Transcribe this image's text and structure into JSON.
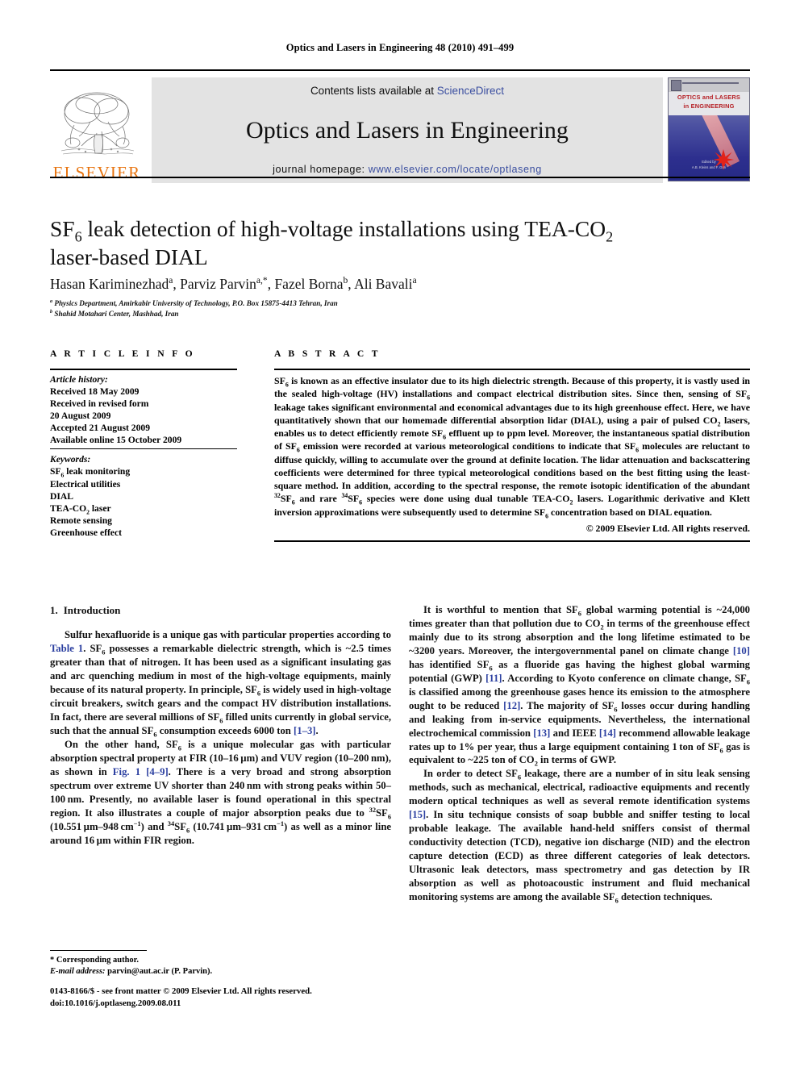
{
  "running_head": "Optics and Lasers in Engineering 48 (2010) 491–499",
  "banner": {
    "publisher_name": "ELSEVIER",
    "contents_prefix": "Contents lists available at ",
    "contents_link": "ScienceDirect",
    "journal_title": "Optics and Lasers in Engineering",
    "homepage_prefix": "journal homepage: ",
    "homepage_url": "www.elsevier.com/locate/optlaseng",
    "cover": {
      "title_line1": "OPTICS and LASERS",
      "title_line2": "in ENGINEERING",
      "credit_line1": "Edited by",
      "credit_line2": "A.B. Kleins and F. Gori"
    },
    "link_color": "#3b4fa0",
    "elsevier_orange": "#E87511"
  },
  "article": {
    "title_line1_a": "SF",
    "title_line1_sub": "6",
    "title_line1_b": " leak detection of high-voltage installations using TEA-CO",
    "title_line1_sub2": "2",
    "title_line2": "laser-based DIAL",
    "authors_plain": "Hasan Kariminezhad a, Parviz Parvin a,*, Fazel Borna b, Ali Bavali a",
    "affiliation_a": "Physics Department, Amirkabir University of Technology, P.O. Box 15875-4413 Tehran, Iran",
    "affiliation_b": "Shahid Motahari Center, Mashhad, Iran"
  },
  "article_info": {
    "heading": "A R T I C L E   I N F O",
    "history_label": "Article history:",
    "history": [
      "Received 18 May 2009",
      "Received in revised form",
      "20 August 2009",
      "Accepted 21 August 2009",
      "Available online 15 October 2009"
    ],
    "keywords_label": "Keywords:",
    "keywords": [
      "SF6 leak monitoring",
      "Electrical utilities",
      "DIAL",
      "TEA-CO2 laser",
      "Remote sensing",
      "Greenhouse effect"
    ]
  },
  "abstract": {
    "heading": "A B S T R A C T",
    "copyright": "© 2009 Elsevier Ltd. All rights reserved."
  },
  "introduction": {
    "section_number": "1.",
    "section_title": "Introduction"
  },
  "footnotes": {
    "corresponding": "* Corresponding author.",
    "email_label": "E-mail address:",
    "email": "parvin@aut.ac.ir (P. Parvin).",
    "issn_line": "0143-8166/$ - see front matter © 2009 Elsevier Ltd. All rights reserved.",
    "doi_line": "doi:10.1016/j.optlaseng.2009.08.011"
  }
}
